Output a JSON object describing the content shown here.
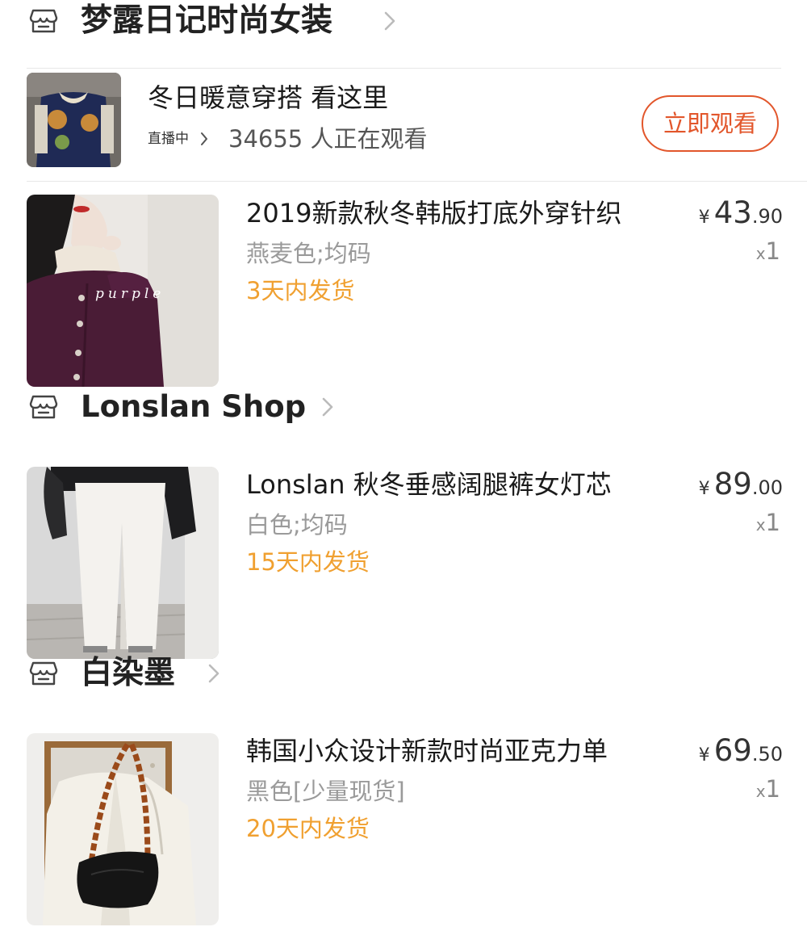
{
  "shops": [
    {
      "name": "梦露日记时尚女装",
      "live": {
        "title": "冬日暖意穿搭 看这里",
        "status": "直播中",
        "viewers": "34655 人正在观看",
        "watch_label": "立即观看"
      },
      "products": [
        {
          "title": "2019新款秋冬韩版打底外穿针织",
          "spec": "燕麦色;均码",
          "shipping": "3天内发货",
          "currency": "¥",
          "price_int": "43",
          "price_dec": ".90",
          "qty_prefix": "x",
          "qty": "1",
          "image_text": "purple"
        }
      ]
    },
    {
      "name": "Lonslan Shop",
      "products": [
        {
          "title": "Lonslan 秋冬垂感阔腿裤女灯芯",
          "spec": "白色;均码",
          "shipping": "15天内发货",
          "currency": "¥",
          "price_int": "89",
          "price_dec": ".00",
          "qty_prefix": "x",
          "qty": "1"
        }
      ]
    },
    {
      "name": "白染墨",
      "products": [
        {
          "title": "韩国小众设计新款时尚亚克力单",
          "spec": "黑色[少量现货]",
          "shipping": "20天内发货",
          "currency": "¥",
          "price_int": "69",
          "price_dec": ".50",
          "qty_prefix": "x",
          "qty": "1"
        }
      ]
    }
  ],
  "colors": {
    "accent": "#e2562b",
    "shipping": "#f0a030",
    "spec": "#9a9a9a"
  },
  "icons": {
    "shop": "store-icon",
    "chevron": "chevron-right-icon"
  }
}
